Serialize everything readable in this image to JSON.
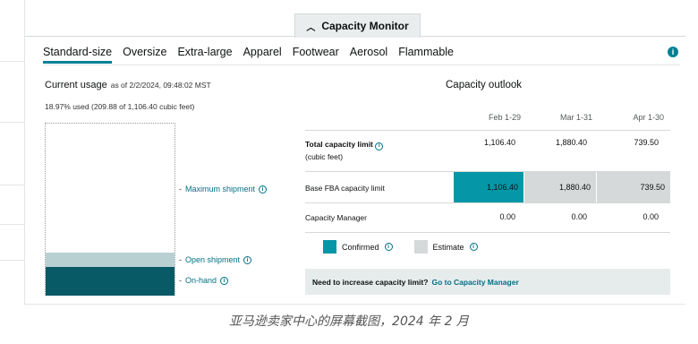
{
  "panel": {
    "toggle_label": "Capacity Monitor",
    "toggle_icon": "chevron-up-icon"
  },
  "tabs": [
    {
      "label": "Standard-size",
      "active": true
    },
    {
      "label": "Oversize"
    },
    {
      "label": "Extra-large"
    },
    {
      "label": "Apparel"
    },
    {
      "label": "Footwear"
    },
    {
      "label": "Aerosol"
    },
    {
      "label": "Flammable"
    }
  ],
  "info_badge": "i",
  "current_usage": {
    "title": "Current usage",
    "as_of": "as of 2/2/2024, 09:48:02 MST",
    "summary": "18.97% used (209.88 of 1,106.40 cubic feet)",
    "open_fraction": 0.081,
    "onhand_fraction": 0.165,
    "labels": {
      "maximum": "Maximum shipment",
      "open": "Open shipment",
      "onhand": "On-hand"
    }
  },
  "outlook": {
    "title": "Capacity outlook",
    "columns": [
      "Feb 1-29",
      "Mar 1-31",
      "Apr 1-30"
    ],
    "rows": {
      "total": {
        "label": "Total capacity limit",
        "sub": "(cubic feet)",
        "values": [
          "1,106.40",
          "1,880.40",
          "739.50"
        ]
      },
      "base": {
        "label": "Base FBA capacity limit",
        "values": [
          "1,106.40",
          "1,880.40",
          "739.50"
        ]
      },
      "manager": {
        "label": "Capacity Manager",
        "values": [
          "0.00",
          "0.00",
          "0.00"
        ]
      }
    },
    "legend": {
      "confirmed": "Confirmed",
      "estimate": "Estimate"
    },
    "colors": {
      "confirmed": "#0597a8",
      "estimate": "#d5d9d9",
      "onhand": "#075a66",
      "open": "#b9d0d3"
    }
  },
  "cta": {
    "text": "Need to increase capacity limit?",
    "link": "Go to Capacity Manager"
  },
  "caption": "亚马逊卖家中心的屏幕截图，2024 年 2 月"
}
